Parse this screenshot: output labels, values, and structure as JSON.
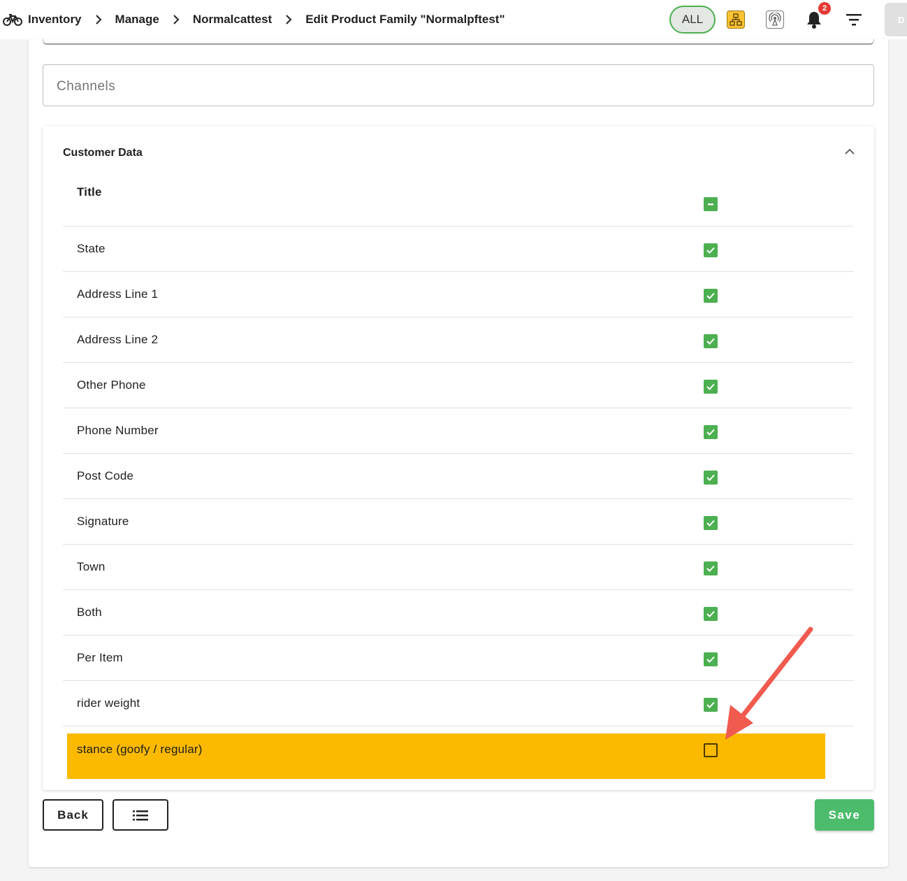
{
  "breadcrumb": {
    "items": [
      "Inventory",
      "Manage",
      "Normalcattest",
      "Edit Product Family \"Normalpftest\""
    ]
  },
  "topbar": {
    "all_label": "ALL",
    "notification_count": "2",
    "avatar_initial": "D",
    "accent_color": "#4caf50",
    "badge_color": "#e53935"
  },
  "form": {
    "channels_placeholder": "Channels"
  },
  "panel": {
    "title": "Customer Data",
    "header_label": "Title",
    "rows": [
      {
        "label": "State",
        "checked": true
      },
      {
        "label": "Address Line 1",
        "checked": true
      },
      {
        "label": "Address Line 2",
        "checked": true
      },
      {
        "label": "Other Phone",
        "checked": true
      },
      {
        "label": "Phone Number",
        "checked": true
      },
      {
        "label": "Post Code",
        "checked": true
      },
      {
        "label": "Signature",
        "checked": true
      },
      {
        "label": "Town",
        "checked": true
      },
      {
        "label": "Both",
        "checked": true
      },
      {
        "label": "Per Item",
        "checked": true
      },
      {
        "label": "rider weight",
        "checked": true
      }
    ],
    "highlighted_row": {
      "label": "stance (goofy / regular)",
      "checked": false,
      "highlight_color": "#fbb900"
    }
  },
  "actions": {
    "back_label": "Back",
    "save_label": "Save"
  },
  "annotation": {
    "arrow_color": "#f05a4f"
  }
}
